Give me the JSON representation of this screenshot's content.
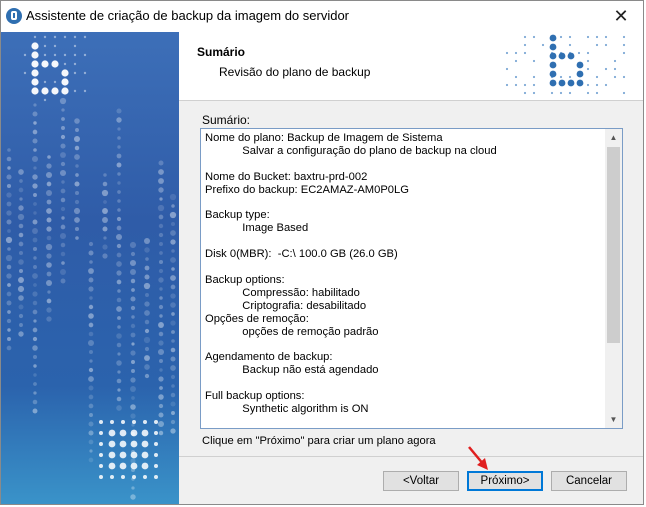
{
  "window": {
    "title": "Assistente de criação de backup da imagem do servidor",
    "close_glyph": "✕"
  },
  "header": {
    "title": "Sumário",
    "subtitle": "Revisão do plano de backup"
  },
  "main": {
    "section_label": "Sumário:",
    "summary_text": "Nome do plano: Backup de Imagem de Sistema\n            Salvar a configuração do plano de backup na cloud\n\nNome do Bucket: baxtru-prd-002\nPrefixo do backup: EC2AMAZ-AM0P0LG\n\nBackup type:\n            Image Based\n\nDisk 0(MBR):  -C:\\ 100.0 GB (26.0 GB)\n\nBackup options:\n            Compressão: habilitado\n            Criptografia: desabilitado\nOpções de remoção:\n            opções de remoção padrão\n\nAgendamento de backup:\n            Backup não está agendado\n\nFull backup options:\n            Synthetic algorithm is ON",
    "hint": "Clique em \"Próximo\" para criar um plano agora",
    "scroll_up_glyph": "▲",
    "scroll_down_glyph": "▼"
  },
  "buttons": {
    "back": "<Voltar",
    "next": "Próximo>",
    "cancel": "Cancelar"
  },
  "colors": {
    "sidebar_top": "#3d6fb8",
    "sidebar_bottom": "#3a93c9",
    "accent_blue": "#0078d7",
    "annotation_arrow": "#e02020"
  },
  "icons": {
    "app": "server-backup-icon",
    "annotation": "red-arrow-icon"
  }
}
